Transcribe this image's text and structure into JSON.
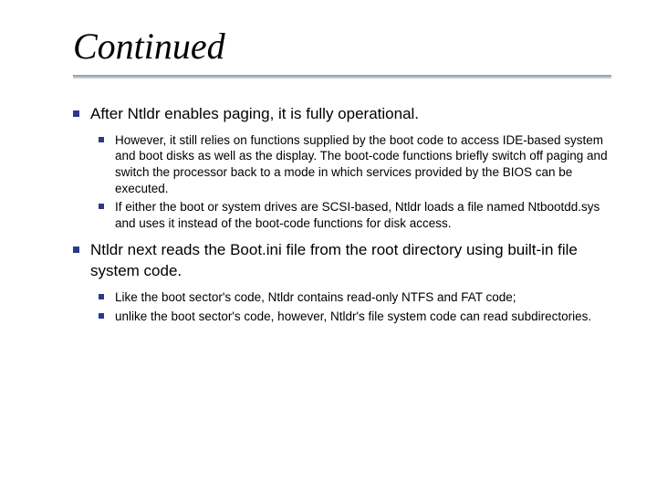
{
  "title": "Continued",
  "bullets": [
    {
      "text": "After Ntldr enables paging, it is fully operational.",
      "children": [
        {
          "text": "However, it still relies on functions supplied by the boot code to access IDE-based system and boot disks as well as the display. The boot-code functions briefly switch off paging and switch the processor back to a mode in which services provided by the BIOS can be executed."
        },
        {
          "text": "If either the boot or system drives are SCSI-based, Ntldr loads a file named Ntbootdd.sys and uses it instead of the boot-code functions for disk access."
        }
      ]
    },
    {
      "text": "Ntldr next reads the Boot.ini file from the root directory using built-in file system code.",
      "children": [
        {
          "text": "Like the boot sector's code, Ntldr contains read-only NTFS and FAT code;"
        },
        {
          "text": "unlike the boot sector's code, however, Ntldr's file system code can read subdirectories."
        }
      ]
    }
  ]
}
